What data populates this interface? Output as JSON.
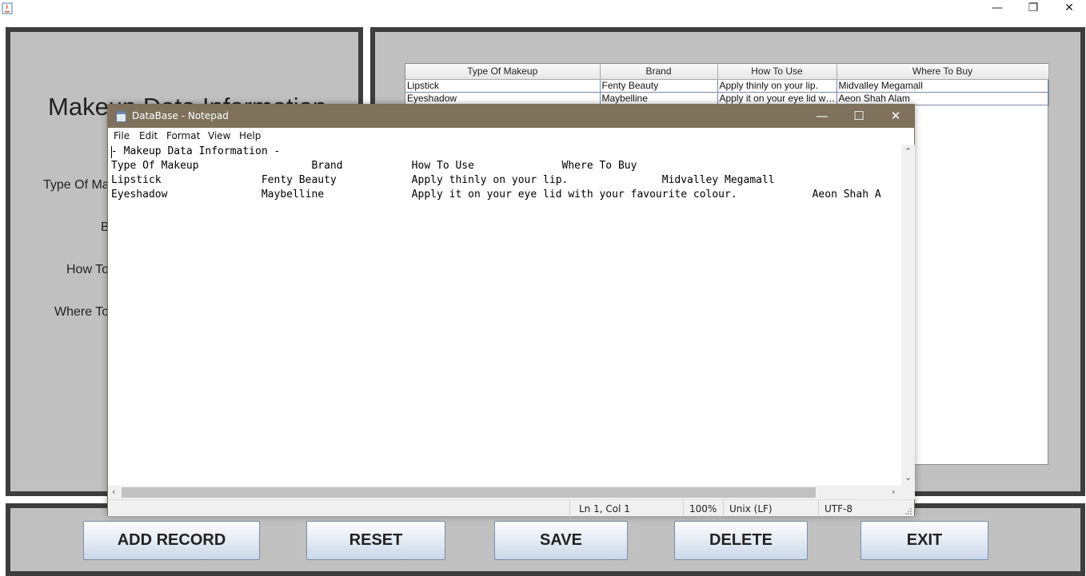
{
  "main_window": {
    "controls": {
      "minimize": "—",
      "restore": "❐",
      "close": "✕"
    }
  },
  "form": {
    "title": "Makeup Data Information",
    "labels": [
      "Type Of Makeup",
      "Brand",
      "How To Use",
      "Where To Buy"
    ]
  },
  "table": {
    "headers": [
      "Type Of Makeup",
      "Brand",
      "How To Use",
      "Where To Buy"
    ],
    "rows": [
      [
        "Lipstick",
        "Fenty Beauty",
        "Apply thinly on your lip.",
        "Midvalley Megamall"
      ],
      [
        "Eyeshadow",
        "Maybelline",
        "Apply it on your eye lid wit...",
        "Aeon Shah Alam"
      ]
    ]
  },
  "buttons": {
    "add": "ADD RECORD",
    "reset": "RESET",
    "save": "SAVE",
    "delete": "DELETE",
    "exit": "EXIT"
  },
  "notepad": {
    "title": "DataBase - Notepad",
    "controls": {
      "minimize": "—",
      "maximize": "☐",
      "close": "✕"
    },
    "menu": [
      "File",
      "Edit",
      "Format",
      "View",
      "Help"
    ],
    "lines": [
      "- Makeup Data Information -",
      "Type Of Makeup                  Brand           How To Use              Where To Buy",
      "Lipstick                Fenty Beauty            Apply thinly on your lip.               Midvalley Megamall",
      "Eyeshadow               Maybelline              Apply it on your eye lid with your favourite colour.            Aeon Shah A"
    ],
    "status": {
      "position": "Ln 1, Col 1",
      "zoom": "100%",
      "line_ending": "Unix (LF)",
      "encoding": "UTF-8"
    }
  }
}
